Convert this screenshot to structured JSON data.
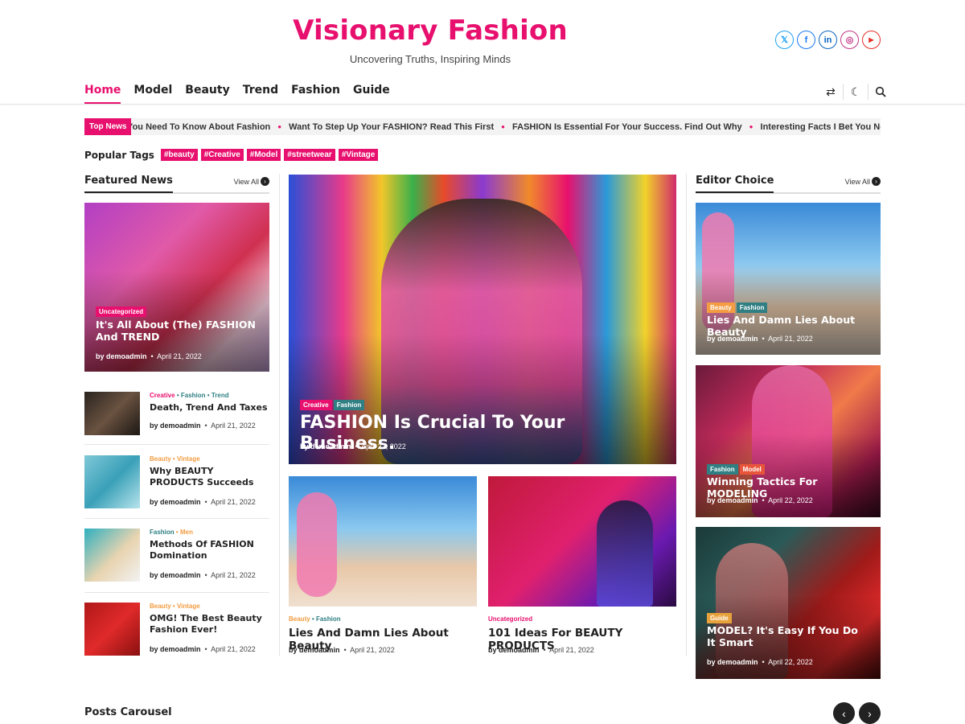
{
  "site": {
    "title": "Visionary Fashion",
    "tagline": "Uncovering Truths, Inspiring Minds"
  },
  "social": [
    {
      "icon": "x-twitter-icon",
      "glyph": "𝕏",
      "color": "#1da1f2"
    },
    {
      "icon": "facebook-icon",
      "glyph": "f",
      "color": "#1877f2"
    },
    {
      "icon": "linkedin-icon",
      "glyph": "in",
      "color": "#0a66c2"
    },
    {
      "icon": "instagram-icon",
      "glyph": "◎",
      "color": "#c13584"
    },
    {
      "icon": "youtube-icon",
      "glyph": "▶",
      "color": "#e52d27"
    }
  ],
  "nav": {
    "items": [
      "Home",
      "Model",
      "Beauty",
      "Trend",
      "Fashion",
      "Guide"
    ],
    "active": "Home"
  },
  "ticker": {
    "label": "Top News",
    "items": [
      "Important Thing You Need To Know About Fashion",
      "Want To Step Up Your FASHION? Read This First",
      "FASHION Is Essential For Your Success. Find Out Why",
      "Interesting Facts I Bet You Never Knew About Fashion"
    ]
  },
  "popular_tags": {
    "label": "Popular Tags",
    "tags": [
      "#beauty",
      "#Creative",
      "#Model",
      "#streetwear",
      "#Vintage"
    ]
  },
  "featured": {
    "heading": "Featured News",
    "view_all": "View All",
    "main": {
      "category": "Uncategorized",
      "title": "It's All About (The) FASHION And TREND",
      "author": "by demoadmin",
      "date": "April 21, 2022"
    },
    "list": [
      {
        "cats": [
          "Creative",
          "Fashion",
          "Trend"
        ],
        "title": "Death, Trend And Taxes",
        "author": "by demoadmin",
        "date": "April 21, 2022"
      },
      {
        "cats": [
          "Beauty",
          "Vintage"
        ],
        "title": "Why BEAUTY PRODUCTS Succeeds",
        "author": "by demoadmin",
        "date": "April 21, 2022"
      },
      {
        "cats": [
          "Fashion",
          "Men"
        ],
        "title": "Methods Of FASHION Domination",
        "author": "by demoadmin",
        "date": "April 21, 2022"
      },
      {
        "cats": [
          "Beauty",
          "Vintage"
        ],
        "title": "OMG! The Best Beauty Fashion Ever!",
        "author": "by demoadmin",
        "date": "April 21, 2022"
      }
    ]
  },
  "center": {
    "hero": {
      "cats": [
        "Creative",
        "Fashion"
      ],
      "title": "FASHION Is Crucial To Your Business.",
      "author": "by demoadmin",
      "date": "April 22, 2022"
    },
    "cards": [
      {
        "cats": [
          "Beauty",
          "Fashion"
        ],
        "title": "Lies And Damn Lies About Beauty",
        "author": "by demoadmin",
        "date": "April 21, 2022"
      },
      {
        "cats": [
          "Uncategorized"
        ],
        "title": "101 Ideas For BEAUTY PRODUCTS",
        "author": "by demoadmin",
        "date": "April 21, 2022"
      }
    ]
  },
  "editor": {
    "heading": "Editor Choice",
    "view_all": "View All",
    "items": [
      {
        "cats": [
          "Beauty",
          "Fashion"
        ],
        "title": "Lies And Damn Lies About Beauty",
        "author": "by demoadmin",
        "date": "April 21, 2022"
      },
      {
        "cats": [
          "Fashion",
          "Model"
        ],
        "title": "Winning Tactics For MODELING",
        "author": "by demoadmin",
        "date": "April 22, 2022"
      },
      {
        "cats": [
          "Guide"
        ],
        "title": "MODEL? It's Easy If You Do It Smart",
        "author": "by demoadmin",
        "date": "April 22, 2022"
      }
    ]
  },
  "carousel": {
    "heading": "Posts Carousel",
    "prev": "‹",
    "next": "›"
  },
  "colors": {
    "accent": "#e8106e",
    "cat_colors": {
      "Creative": "#e8106e",
      "Fashion": "#2f7f83",
      "Trend": "#2f7f83",
      "Beauty": "#f39c42",
      "Vintage": "#e8106e",
      "Men": "#f39c42",
      "Model": "#e8553b",
      "Guide": "#e8a23b",
      "Uncategorized": "#e8106e"
    }
  }
}
